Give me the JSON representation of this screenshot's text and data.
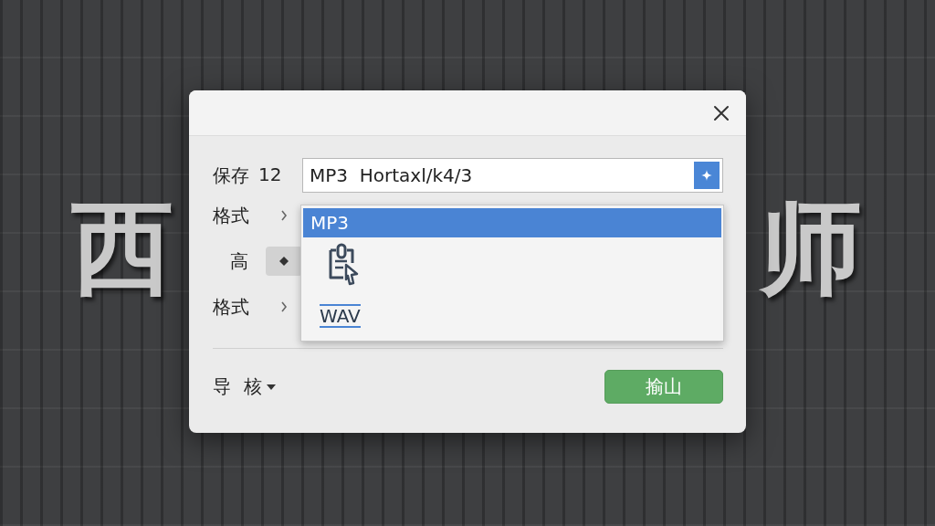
{
  "background": {
    "title_left": "西",
    "title_right": "师"
  },
  "save_row": {
    "label": "保存",
    "number": "12",
    "value": "MP3  Hortaxl/k4/3"
  },
  "rows": [
    {
      "kind": "chevron",
      "label": "格式"
    },
    {
      "kind": "stepper",
      "label": "高"
    },
    {
      "kind": "chevron",
      "label": "格式"
    }
  ],
  "dropdown": {
    "options": [
      {
        "kind": "text",
        "label": "MP3",
        "selected": true
      },
      {
        "kind": "icon",
        "selected": false
      },
      {
        "kind": "badge",
        "label": "WAV",
        "selected": false
      }
    ]
  },
  "footer": {
    "menu_label": "导 核",
    "button": "揄山"
  }
}
